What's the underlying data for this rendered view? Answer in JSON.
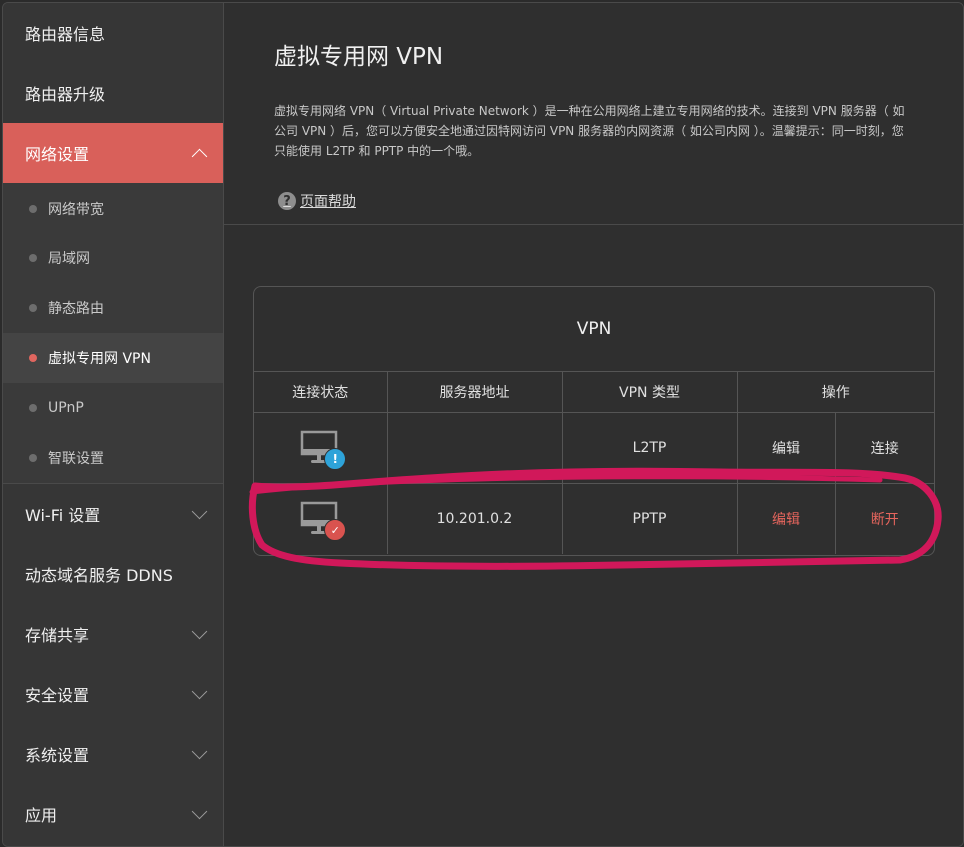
{
  "sidebar": {
    "items_top": [
      {
        "label": "路由器信息"
      },
      {
        "label": "路由器升级"
      }
    ],
    "active_group": {
      "label": "网络设置"
    },
    "submenu": [
      {
        "label": "网络带宽"
      },
      {
        "label": "局域网"
      },
      {
        "label": "静态路由"
      },
      {
        "label": "虚拟专用网 VPN"
      },
      {
        "label": "UPnP"
      },
      {
        "label": "智联设置"
      }
    ],
    "items_bottom": [
      {
        "label": "Wi-Fi 设置"
      },
      {
        "label": "动态域名服务 DDNS"
      },
      {
        "label": "存储共享"
      },
      {
        "label": "安全设置"
      },
      {
        "label": "系统设置"
      },
      {
        "label": "应用"
      }
    ]
  },
  "main": {
    "title": "虚拟专用网 VPN",
    "description": "虚拟专用网络 VPN（ Virtual Private Network ）是一种在公用网络上建立专用网络的技术。连接到 VPN 服务器（ 如公司 VPN ）后，您可以方便安全地通过因特网访问 VPN 服务器的内网资源（ 如公司内网 ）。温馨提示：同一时刻，您只能使用 L2TP 和 PPTP 中的一个哦。",
    "help_label": "页面帮助",
    "help_icon": "?",
    "card": {
      "title": "VPN",
      "headers": [
        "连接状态",
        "服务器地址",
        "VPN 类型",
        "操作"
      ],
      "rows": [
        {
          "status": "warning",
          "badge": "!",
          "server": "",
          "type": "L2TP",
          "edit": "编辑",
          "action": "连接"
        },
        {
          "status": "connected",
          "badge": "✓",
          "server": "10.201.0.2",
          "type": "PPTP",
          "edit": "编辑",
          "action": "断开"
        }
      ]
    }
  },
  "colors": {
    "accent": "#d9605a",
    "link_red": "#e5655d",
    "info_blue": "#2ea3d9",
    "annotation": "#d1185a"
  }
}
